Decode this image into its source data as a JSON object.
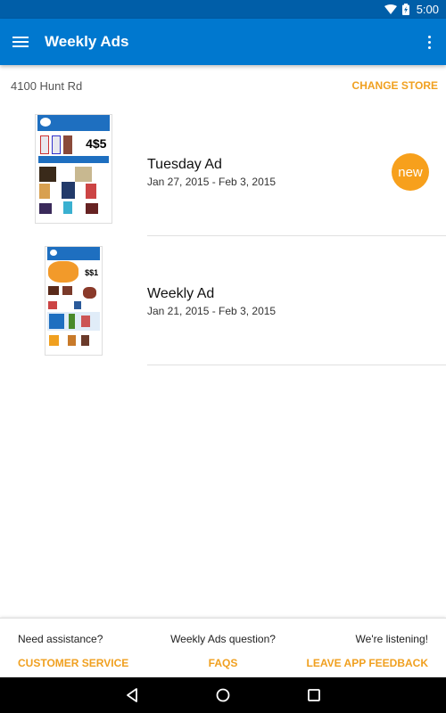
{
  "status_bar": {
    "time": "5:00",
    "icons": [
      "wifi-icon",
      "battery-charging-icon"
    ]
  },
  "app_bar": {
    "title": "Weekly Ads",
    "menu_icon": "hamburger-menu-icon",
    "overflow_icon": "more-vert-icon"
  },
  "store": {
    "name": "4100 Hunt Rd",
    "change_label": "CHANGE STORE"
  },
  "ads": [
    {
      "title": "Tuesday Ad",
      "dates": "Jan 27, 2015 - Feb 3, 2015",
      "badge": "new",
      "thumbnail": "tuesday-ad-flyer-thumbnail"
    },
    {
      "title": "Weekly Ad",
      "dates": "Jan 21, 2015 - Feb 3, 2015",
      "thumbnail": "weekly-ad-flyer-thumbnail"
    }
  ],
  "footer": {
    "left": {
      "question": "Need assistance?",
      "link": "CUSTOMER SERVICE"
    },
    "middle": {
      "question": "Weekly Ads question?",
      "link": "FAQS"
    },
    "right": {
      "question": "We're listening!",
      "link": "LEAVE APP FEEDBACK"
    }
  },
  "nav_bar": {
    "buttons": [
      "back-icon",
      "home-icon",
      "recents-icon"
    ]
  },
  "colors": {
    "status_bar": "#005ea8",
    "app_bar": "#0078cf",
    "accent": "#f0a020",
    "badge": "#f7a01c"
  }
}
